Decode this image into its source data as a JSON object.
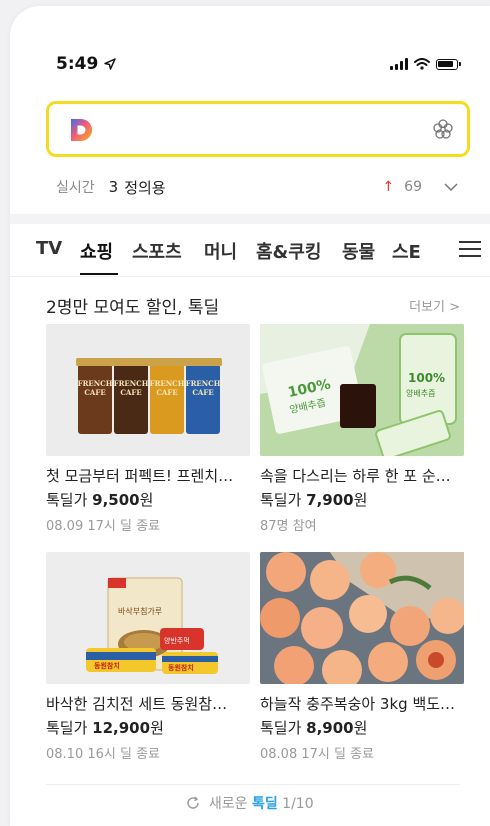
{
  "status_bar": {
    "time": "5:49"
  },
  "search": {
    "placeholder": ""
  },
  "trending": {
    "label": "실시간",
    "rank": "3",
    "term": "정의용",
    "count": "69"
  },
  "tabs": [
    "TV",
    "쇼핑",
    "스포츠",
    "머니",
    "홈&쿠킹",
    "동물",
    "스E"
  ],
  "active_tab": "쇼핑",
  "section": {
    "title": "2명만 모여도 할인, 톡딜",
    "more": "더보기 >"
  },
  "products": [
    {
      "title": "첫 모금부터 퍼펙트! 프렌치…",
      "price_prefix": "톡딜가 ",
      "price": "9,500",
      "price_suffix": "원",
      "meta": "08.09 17시 딜 종료",
      "image": "french-cafe-cups",
      "image_text": "FRENCH CAFÉ"
    },
    {
      "title": "속을 다스리는 하루 한 포 순…",
      "price_prefix": "톡딜가 ",
      "price": "7,900",
      "price_suffix": "원",
      "meta": "87명 참여",
      "image": "cabbage-juice-pouches",
      "image_text": "100% 양배추즙"
    },
    {
      "title": "바삭한 김치전 세트 동원참…",
      "price_prefix": "톡딜가 ",
      "price": "12,900",
      "price_suffix": "원",
      "meta": "08.10 16시 딜 종료",
      "image": "kimchi-pancake-set",
      "image_text": "바삭부침가루"
    },
    {
      "title": "하늘작 충주복숭아 3kg 백도…",
      "price_prefix": "톡딜가 ",
      "price": "8,900",
      "price_suffix": "원",
      "meta": "08.08 17시 딜 종료",
      "image": "peaches",
      "image_text": ""
    }
  ],
  "footer": {
    "prefix": "새로운",
    "highlight": "톡딜",
    "page": "1/10"
  },
  "colors": {
    "search_border": "#f5dc1f",
    "up_arrow": "#e8372c",
    "link_blue": "#2aa0e8",
    "logo_d": "#f5a623"
  }
}
